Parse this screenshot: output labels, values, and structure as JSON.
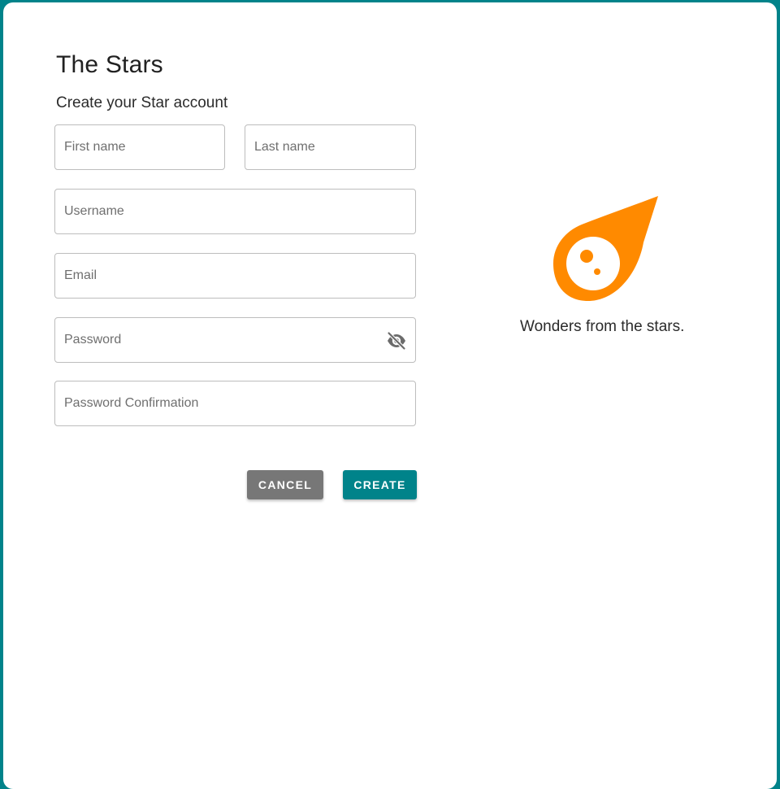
{
  "header": {
    "title": "The Stars",
    "subtitle": "Create your Star account"
  },
  "form": {
    "first_name": {
      "placeholder": "First name",
      "value": ""
    },
    "last_name": {
      "placeholder": "Last name",
      "value": ""
    },
    "username": {
      "placeholder": "Username",
      "value": ""
    },
    "email": {
      "placeholder": "Email",
      "value": ""
    },
    "password": {
      "placeholder": "Password",
      "value": "",
      "toggle_icon": "eye-off-icon"
    },
    "password_confirmation": {
      "placeholder": "Password Confirmation",
      "value": ""
    }
  },
  "actions": {
    "cancel_label": "CANCEL",
    "create_label": "CREATE"
  },
  "branding": {
    "logo_icon": "meteor-icon",
    "tagline": "Wonders from the stars."
  },
  "colors": {
    "background": "#00838a",
    "primary": "#00838a",
    "cancel": "#777777",
    "logo": "#ff8a00"
  }
}
